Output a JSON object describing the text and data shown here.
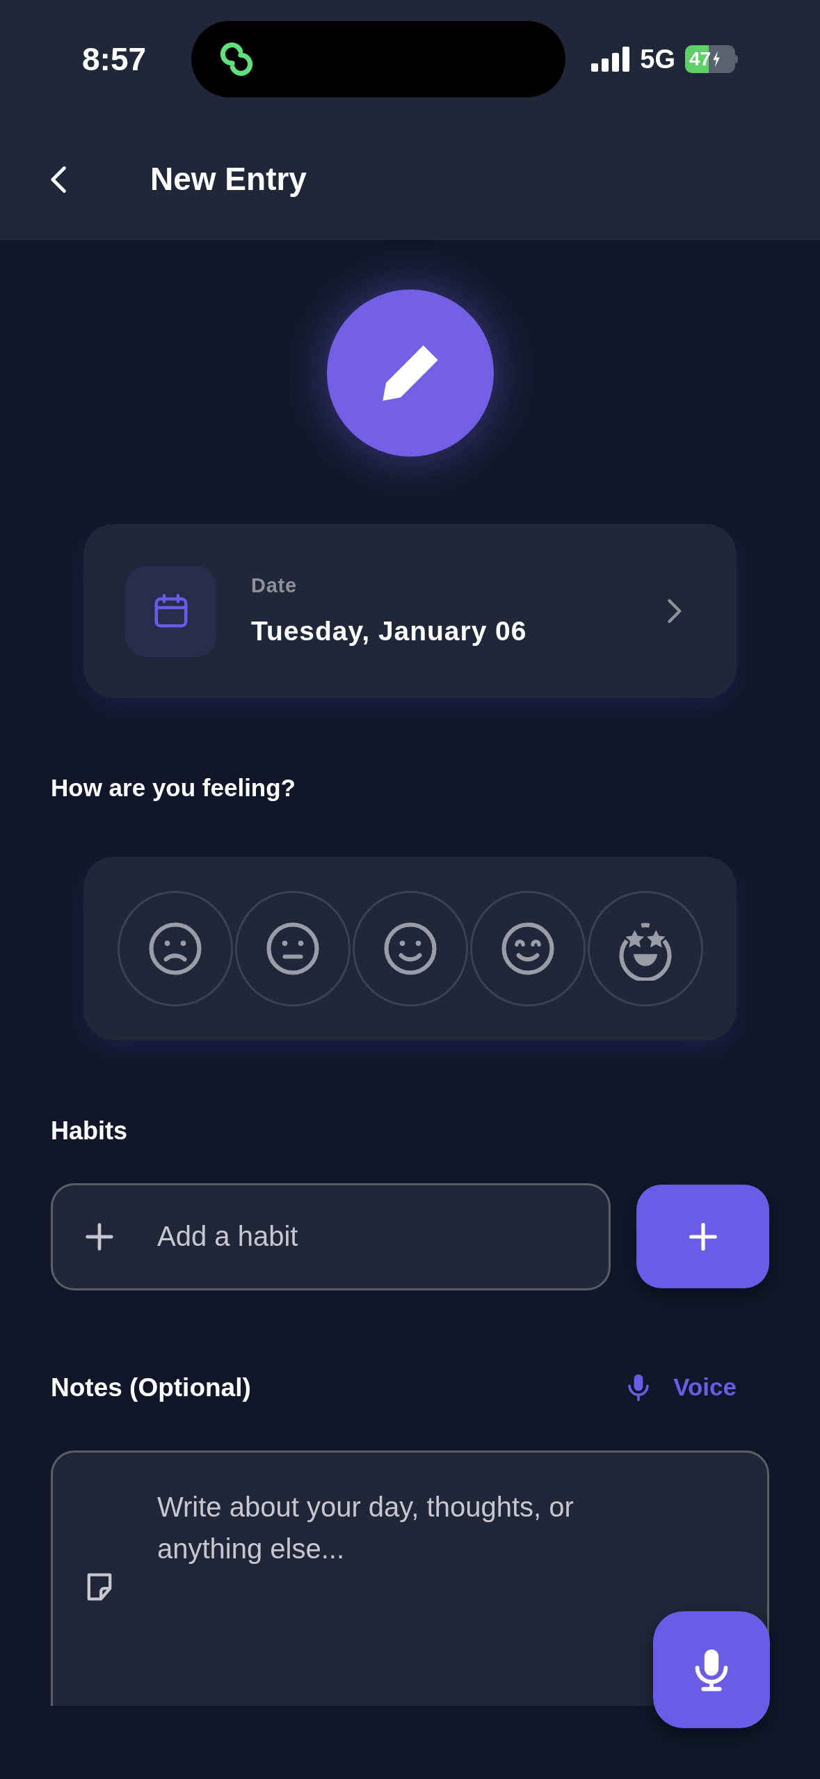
{
  "status_bar": {
    "time": "8:57",
    "network": "5G",
    "battery": "47"
  },
  "header": {
    "title": "New Entry"
  },
  "date_card": {
    "label": "Date",
    "value": "Tuesday, January 06"
  },
  "mood_section": {
    "title": "How are you feeling?",
    "moods": [
      {
        "kind": "sad",
        "selected": false
      },
      {
        "kind": "neutral",
        "selected": false
      },
      {
        "kind": "smile",
        "selected": false
      },
      {
        "kind": "happy",
        "selected": false
      },
      {
        "kind": "starstruck",
        "selected": false
      }
    ]
  },
  "habits": {
    "title": "Habits",
    "placeholder": "Add a habit"
  },
  "notes": {
    "title": "Notes (Optional)",
    "voice_label": "Voice",
    "placeholder": "Write about your day, thoughts, or anything else..."
  }
}
